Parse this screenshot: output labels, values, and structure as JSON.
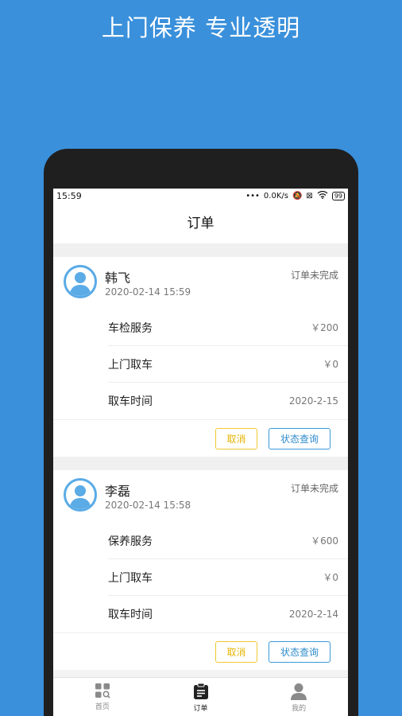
{
  "promo": {
    "headline": "上门保养  专业透明"
  },
  "status_bar": {
    "time": "15:59",
    "speed": "0.0K/s",
    "battery": "99"
  },
  "navbar": {
    "title": "订单"
  },
  "orders": [
    {
      "name": "韩飞",
      "time": "2020-02-14 15:59",
      "state": "订单未完成",
      "rows": [
        {
          "label": "车检服务",
          "value": "￥200"
        },
        {
          "label": "上门取车",
          "value": "￥0"
        },
        {
          "label": "取车时间",
          "value": "2020-2-15"
        }
      ],
      "cancel_label": "取消",
      "query_label": "状态查询"
    },
    {
      "name": "李磊",
      "time": "2020-02-14 15:58",
      "state": "订单未完成",
      "rows": [
        {
          "label": "保养服务",
          "value": "￥600"
        },
        {
          "label": "上门取车",
          "value": "￥0"
        },
        {
          "label": "取车时间",
          "value": "2020-2-14"
        }
      ],
      "cancel_label": "取消",
      "query_label": "状态查询"
    }
  ],
  "tabbar": {
    "items": [
      {
        "label": "首页",
        "icon": "home-grid-icon",
        "active": false
      },
      {
        "label": "订单",
        "icon": "clipboard-icon",
        "active": true
      },
      {
        "label": "我的",
        "icon": "user-icon",
        "active": false
      }
    ]
  },
  "colors": {
    "background": "#3a90db",
    "avatar_ring": "#5aabe6",
    "cancel": "#e6b400",
    "query": "#2d8bcc"
  }
}
